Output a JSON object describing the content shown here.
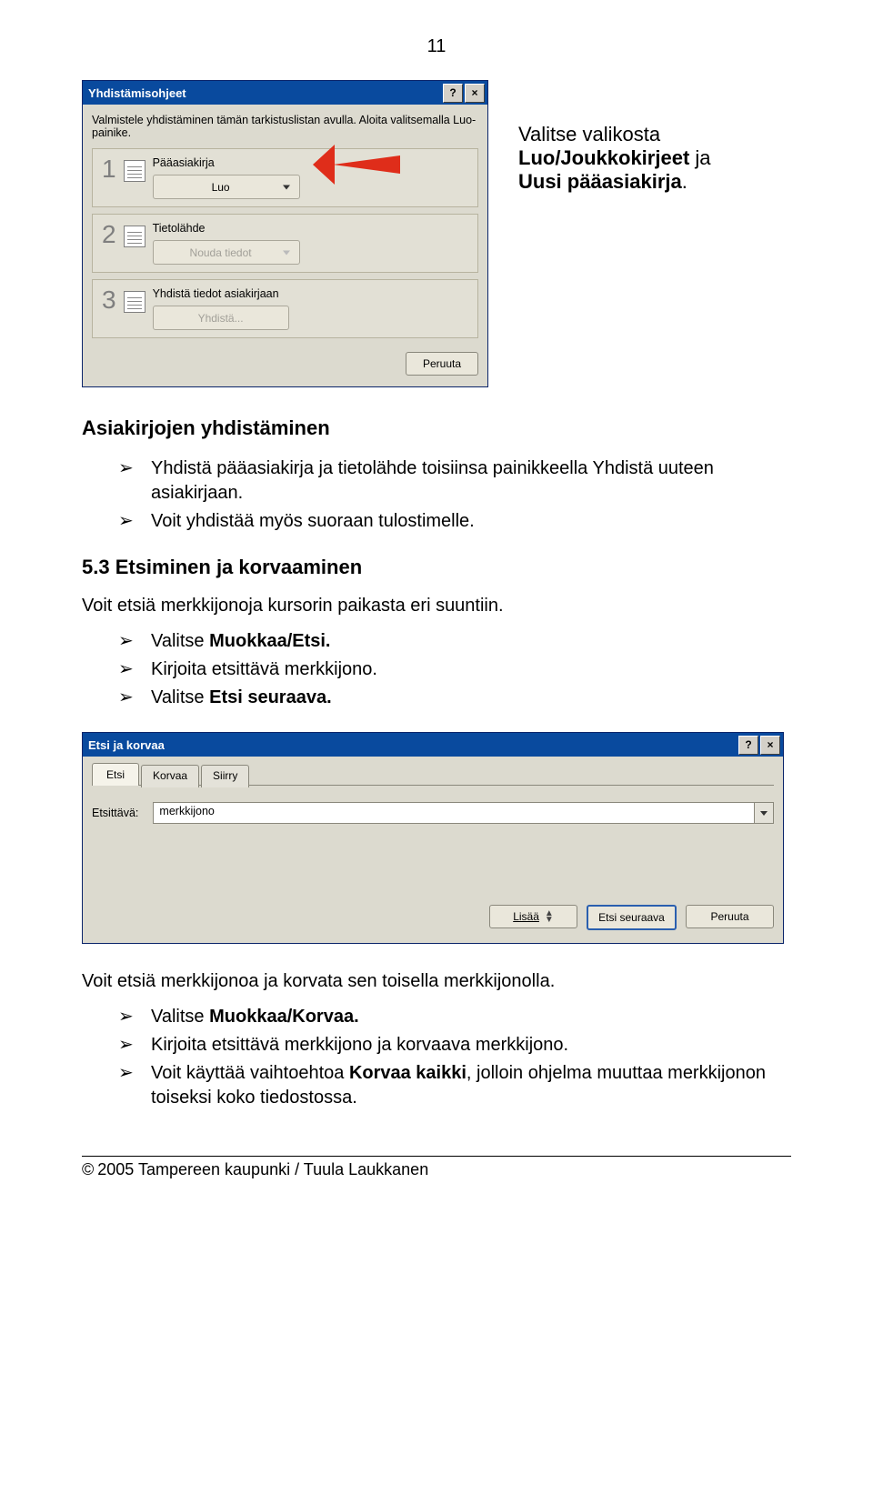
{
  "page_number": "11",
  "dialog1": {
    "title": "Yhdistämisohjeet",
    "help_btn": "?",
    "close_btn": "×",
    "intro": "Valmistele yhdistäminen tämän tarkistuslistan avulla. Aloita valitsemalla Luo-painike.",
    "steps": [
      {
        "label": "Pääasiakirja",
        "button": "Luo"
      },
      {
        "label": "Tietolähde",
        "button": "Nouda tiedot"
      },
      {
        "label": "Yhdistä tiedot asiakirjaan",
        "button": "Yhdistä..."
      }
    ],
    "cancel": "Peruuta"
  },
  "callout": {
    "line1": "Valitse valikosta",
    "line2_a": "Luo/Joukkokirjeet",
    "line2_b": " ja",
    "line3": "Uusi pääasiakirja"
  },
  "section1": {
    "heading": "Asiakirjojen yhdistäminen",
    "bullets": [
      {
        "pre": "Yhdistä pääasiakirja ja tietolähde toisiinsa painikkeella Yhdistä uuteen asiakirjaan."
      },
      {
        "pre": "Voit yhdistää myös suoraan tulostimelle."
      }
    ]
  },
  "section2": {
    "heading": "5.3 Etsiminen ja korvaaminen",
    "para": "Voit etsiä merkkijonoja kursorin paikasta eri suuntiin.",
    "bullets": [
      {
        "text_a": "Valitse ",
        "bold": "Muokkaa/Etsi."
      },
      {
        "text_a": "Kirjoita etsittävä merkkijono."
      },
      {
        "text_a": "Valitse ",
        "bold": "Etsi seuraava."
      }
    ]
  },
  "dialog2": {
    "title": "Etsi ja korvaa",
    "tabs": [
      "Etsi",
      "Korvaa",
      "Siirry"
    ],
    "field_label": "Etsittävä:",
    "field_value": "merkkijono",
    "buttons": {
      "more": "Lisää",
      "find_next": "Etsi seuraava",
      "cancel": "Peruuta"
    }
  },
  "section3": {
    "para": "Voit etsiä merkkijonoa ja korvata sen toisella merkkijonolla.",
    "bullets": [
      {
        "text_a": "Valitse ",
        "bold": "Muokkaa/Korvaa."
      },
      {
        "text_a": "Kirjoita etsittävä merkkijono ja korvaava merkkijono."
      },
      {
        "text_a": "Voit käyttää vaihtoehtoa ",
        "bold": "Korvaa kaikki",
        "text_b": ", jolloin ohjelma muuttaa merkkijonon toiseksi koko tiedostossa."
      }
    ]
  },
  "footer": "2005 Tampereen kaupunki / Tuula Laukkanen"
}
